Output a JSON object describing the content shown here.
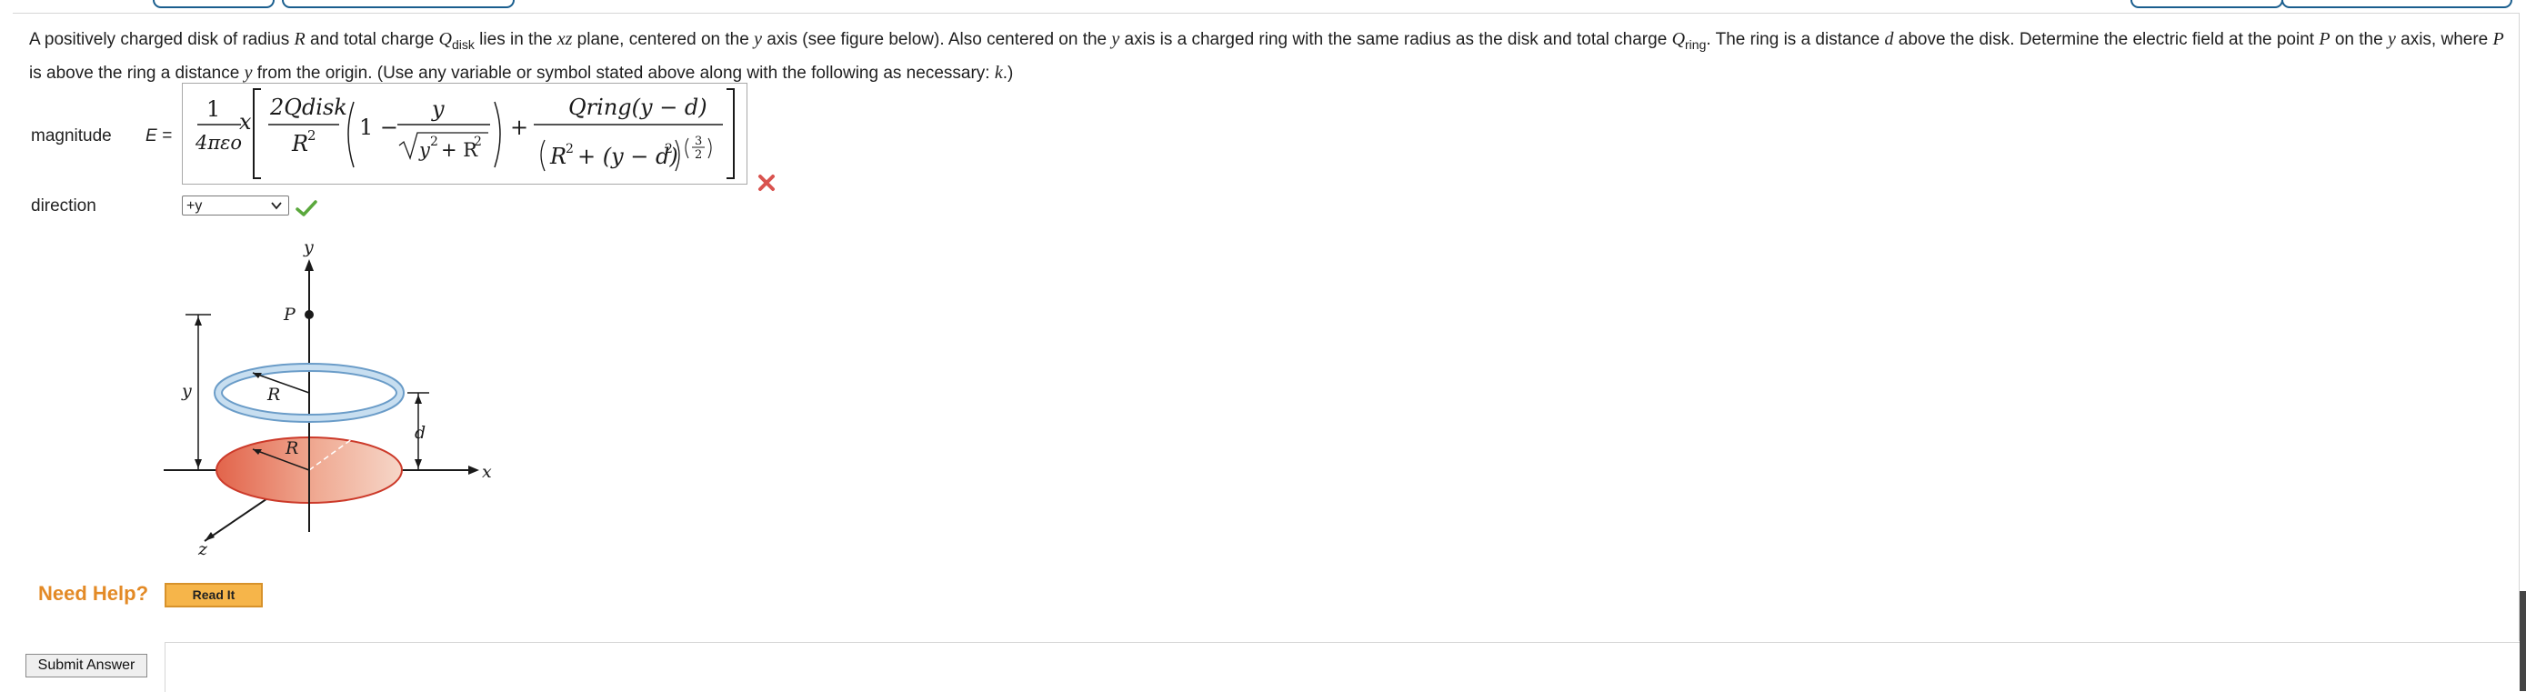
{
  "question": {
    "seg1": "A positively charged disk of radius ",
    "R": "R",
    "seg2": " and total charge ",
    "Q": "Q",
    "disk_sub": "disk",
    "seg3": " lies in the ",
    "xz": "xz",
    "seg4": " plane, centered on the ",
    "y1": "y",
    "seg5": " axis (see figure below). Also centered on the ",
    "y2": "y",
    "seg6": " axis is a charged ring with the same radius as the disk and total charge ",
    "Q2": "Q",
    "ring_sub": "ring",
    "seg7": ". The ring is a distance ",
    "d": "d",
    "seg8": " above the disk. Determine the electric field at the point ",
    "P": "P",
    "seg9": " on the ",
    "y3": "y",
    "seg10": " axis, where ",
    "P2": "P",
    "seg11": " is above the ring a distance ",
    "y4": "y",
    "seg12": " from the origin. (Use any variable or symbol stated above along with the following as necessary: ",
    "k": "k",
    "seg13": ".)"
  },
  "magnitude": {
    "label": "magnitude",
    "eq_label": "E =",
    "expr": {
      "one": "1",
      "four_pi_eps": "4πεo",
      "x": "x",
      "twoQdisk": "2Qdisk",
      "R2": "R",
      "sq": "2",
      "one_minus": "1 −",
      "y": "y",
      "y2R2": "y",
      "plus": "+",
      "Qring": "Qring(y − d)",
      "denR": "R",
      "den_plus": "+ (y − d)",
      "three": "3",
      "two": "2"
    },
    "status": "incorrect"
  },
  "direction": {
    "label": "direction",
    "selected": "+y",
    "status": "correct"
  },
  "figure": {
    "labels": {
      "y_axis": "y",
      "x_axis": "x",
      "z_axis": "z",
      "P": "P",
      "R_ring": "R",
      "R_disk": "R",
      "y_dim": "y",
      "d_dim": "d"
    },
    "colors": {
      "ring": "#9cc3e2",
      "disk": "#e8866a"
    }
  },
  "help": {
    "label": "Need Help?",
    "read_it": "Read It"
  },
  "submit": {
    "label": "Submit Answer"
  },
  "colors": {
    "accent_orange": "#e38a26",
    "correct_green": "#5aa83c",
    "incorrect_red": "#d9534f"
  }
}
